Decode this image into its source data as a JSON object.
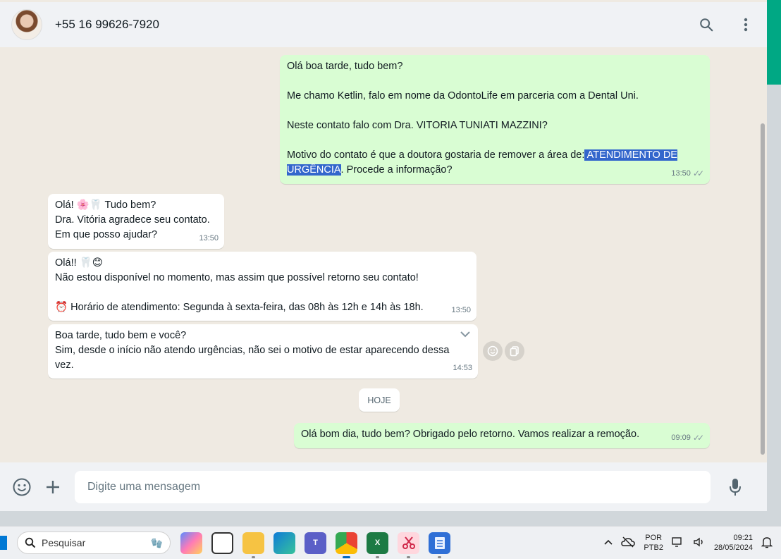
{
  "header": {
    "contact_name": "+55 16 99626-7920"
  },
  "messages": {
    "m1": {
      "l1": "Olá boa tarde, tudo bem?",
      "l2": "Me chamo Ketlin, falo em nome da OdontoLife em parceria com a Dental Uni.",
      "l3": "Neste contato falo com Dra. VITORIA TUNIATI MAZZINI?",
      "l4a": "Motivo do contato é que a doutora gostaria de remover a área de:",
      "l4b": " ATENDIMENTO DE URGÊNCIA",
      "l4c": ". Procede a informação?",
      "time": "13:50"
    },
    "m2": {
      "l1a": "Olá! ",
      "l1b": "🌸🦷",
      "l1c": " Tudo bem?",
      "l2": "Dra. Vitória agradece seu contato.",
      "l3": "Em que posso ajudar?",
      "time": "13:50"
    },
    "m3": {
      "l1a": "Olá!! ",
      "l1b": "🦷😊",
      "l2": "Não estou disponível no momento, mas assim que possível retorno seu contato!",
      "l3a": "⏰",
      "l3b": " Horário de atendimento: Segunda à sexta-feira, das 08h às 12h e 14h às 18h.",
      "time": "13:50"
    },
    "m4": {
      "l1": "Boa tarde, tudo bem e você?",
      "l2": "Sim, desde o início não atendo urgências, não sei o motivo de estar aparecendo dessa vez.",
      "time": "14:53"
    },
    "day_label": "HOJE",
    "m5": {
      "l1": "Olá bom dia, tudo bem? Obrigado pelo retorno. Vamos realizar a remoção.",
      "time": "09:09"
    }
  },
  "footer": {
    "placeholder": "Digite uma mensagem"
  },
  "taskbar": {
    "search_label": "Pesquisar",
    "lang_1": "POR",
    "lang_2": "PTB2",
    "time": "09:21",
    "date": "28/05/2024"
  },
  "colors": {
    "outgoing": "#d9fdd3",
    "incoming": "#ffffff",
    "accent": "#00a884",
    "selection": "#3366cc"
  },
  "icons": [
    "search-icon",
    "menu-dots-icon",
    "emoji-icon",
    "plus-icon",
    "mic-icon",
    "chevron-down-icon",
    "reaction-icon",
    "forward-icon",
    "read-ticks-icon"
  ]
}
